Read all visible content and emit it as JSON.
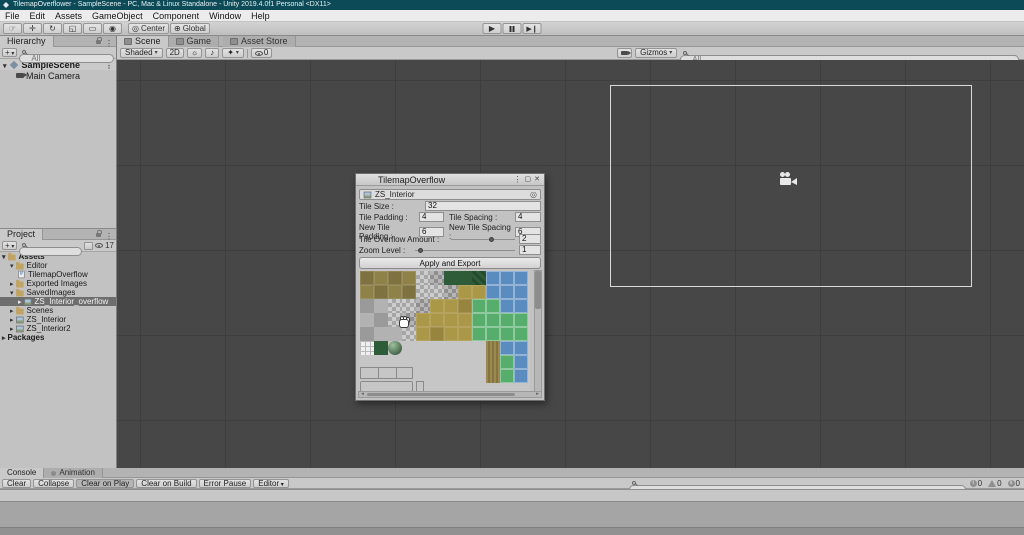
{
  "window": {
    "title": "TilemapOverflower - SampleScene - PC, Mac & Linux Standalone - Unity 2019.4.0f1 Personal <DX11>"
  },
  "menu": {
    "items": [
      "File",
      "Edit",
      "Assets",
      "GameObject",
      "Component",
      "Window",
      "Help"
    ]
  },
  "toolbar": {
    "pivot_label": "Center",
    "space_label": "Global"
  },
  "hierarchy": {
    "tab_label": "Hierarchy",
    "create_button": "+",
    "search_placeholder": "All",
    "rows": [
      {
        "label": "SampleScene"
      },
      {
        "label": "Main Camera"
      }
    ]
  },
  "project": {
    "tab_label": "Project",
    "create_button": "+",
    "hidden_count": "17",
    "rows": [
      {
        "label": "Assets"
      },
      {
        "label": "Editor"
      },
      {
        "label": "TilemapOverflow"
      },
      {
        "label": "Exported Images"
      },
      {
        "label": "SavedImages"
      },
      {
        "label": "ZS_Interior_overflow"
      },
      {
        "label": "Scenes"
      },
      {
        "label": "ZS_Interior"
      },
      {
        "label": "ZS_Interior2"
      },
      {
        "label": "Packages"
      }
    ]
  },
  "scene_view": {
    "tabs": [
      "Scene",
      "Game",
      "Asset Store"
    ],
    "shading_mode": "Shaded",
    "toggle_2d": "2D",
    "visibility_count": "0",
    "gizmos_label": "Gizmos",
    "search_placeholder": "All"
  },
  "tilemap_window": {
    "title": "TilemapOverflow",
    "object_field_value": "ZS_Interior",
    "tile_size_label": "Tile Size :",
    "tile_size_value": "32",
    "tile_padding_label": "Tile Padding :",
    "tile_padding_value": "4",
    "tile_spacing_label": "Tile Spacing :",
    "tile_spacing_value": "4",
    "new_tile_padding_label": "New Tile Padding :",
    "new_tile_padding_value": "6",
    "new_tile_spacing_label": "New Tile Spacing :",
    "new_tile_spacing_value": "6",
    "overflow_label": "Tile Overflow Amount :",
    "overflow_value": "2",
    "zoom_label": "Zoom Level :",
    "zoom_value": "1",
    "apply_button": "Apply and Export",
    "palette": {
      "tile_size": 14,
      "colors": {
        "olv1": "#7e7240",
        "olv2": "#8f8248",
        "gry": "#b2b2b2",
        "gryD": "#9a9a9a",
        "dgr": "#2e5c38",
        "gld": "#ab9748",
        "gldD": "#97853f",
        "grn": "#57ad6b",
        "blu": "#5a8cc0"
      },
      "rows": [
        [
          "olv1",
          "olv2",
          "olv1",
          "olv2",
          "chk",
          "chkD",
          "dgr",
          "dgr",
          "dgrS",
          "blu",
          "blu",
          "blu"
        ],
        [
          "olv2",
          "olv1",
          "olv2",
          "olv1",
          "chk",
          "chk",
          "chkD",
          "gld",
          "gld",
          "blu",
          "blu",
          "blu"
        ],
        [
          "gryD",
          "gry",
          "chk",
          "chk",
          "chkD",
          "gld",
          "gld",
          "gldD",
          "grn",
          "grn",
          "blu",
          "blu"
        ],
        [
          "gry",
          "gryD",
          "chk",
          "chkD",
          "gld",
          "gld",
          "gld",
          "gld",
          "grn",
          "grn",
          "grn",
          "grn"
        ],
        [
          "gryD",
          "gry",
          "gry",
          "chk",
          "gld",
          "gldD",
          "gld",
          "gld",
          "grn",
          "grn",
          "grn",
          "grn"
        ],
        [
          "wgrid",
          "dgr",
          "sph",
          "e",
          "e",
          "e",
          "e",
          "e",
          "e",
          "gldS",
          "blu",
          "blu"
        ],
        [
          "e",
          "e",
          "e",
          "e",
          "e",
          "e",
          "e",
          "e",
          "e",
          "gldS",
          "grn",
          "blu"
        ],
        [
          "e",
          "e",
          "e",
          "e",
          "e",
          "e",
          "e",
          "e",
          "e",
          "gldS",
          "grn",
          "blu"
        ]
      ]
    }
  },
  "console": {
    "tabs": [
      "Console",
      "Animation"
    ],
    "buttons": [
      "Clear",
      "Collapse",
      "Clear on Play",
      "Clear on Build",
      "Error Pause",
      "Editor"
    ],
    "counts": {
      "info": "0",
      "warnings": "0",
      "errors": "0"
    }
  }
}
